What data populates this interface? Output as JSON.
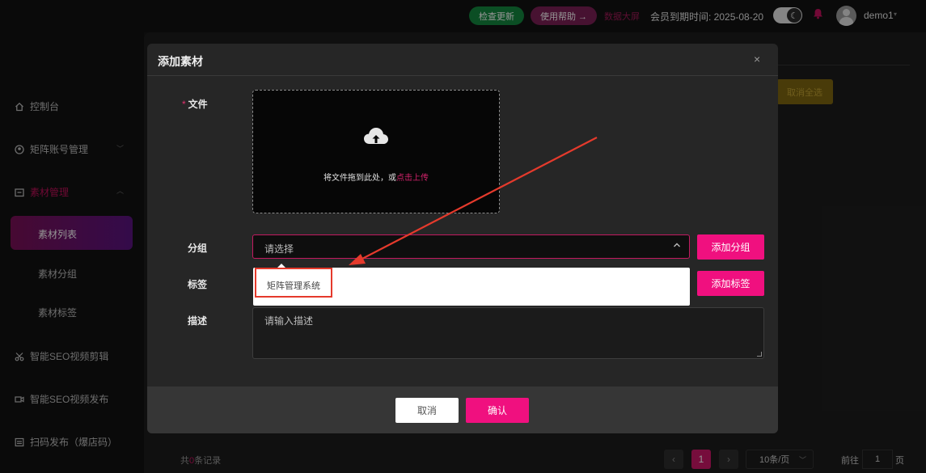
{
  "header": {
    "check_update": "检查更新",
    "help": "使用帮助 →",
    "big_screen": "数据大屏",
    "expire_label": "会员到期时间: 2025-08-20",
    "username": "demo1",
    "moon_icon": "moon-icon",
    "bell_icon": "bell-icon"
  },
  "sidebar": {
    "items": [
      {
        "label": "控制台",
        "icon": "home-icon"
      },
      {
        "label": "矩阵账号管理",
        "icon": "user-circle-icon"
      },
      {
        "label": "素材管理",
        "icon": "folder-icon"
      },
      {
        "label": "智能SEO视频剪辑",
        "icon": "scissors-icon"
      },
      {
        "label": "智能SEO视频发布",
        "icon": "video-icon"
      },
      {
        "label": "扫码发布（爆店码）",
        "icon": "qrcode-icon"
      }
    ],
    "sub_items": [
      "素材列表",
      "素材分组",
      "素材标签"
    ]
  },
  "background": {
    "cancel_select_all": "取消全选",
    "records_prefix": "共",
    "records_count": "0",
    "records_suffix": "条记录",
    "current_page": "1",
    "page_size": "10条/页",
    "goto_label": "前往",
    "goto_value": "1",
    "page_suffix": "页"
  },
  "modal": {
    "title": "添加素材",
    "close": "×",
    "file_label": "文件",
    "upload_text": "将文件拖到此处，或",
    "upload_link": "点击上传",
    "group_label": "分组",
    "group_placeholder": "请选择",
    "add_group": "添加分组",
    "tag_label": "标签",
    "add_tag": "添加标签",
    "desc_label": "描述",
    "desc_placeholder": "请输入描述",
    "cancel": "取消",
    "confirm": "确认"
  },
  "dropdown": {
    "options": [
      "矩阵管理系统"
    ]
  },
  "colors": {
    "accent": "#f0107f",
    "annotation": "#e53a2c"
  }
}
